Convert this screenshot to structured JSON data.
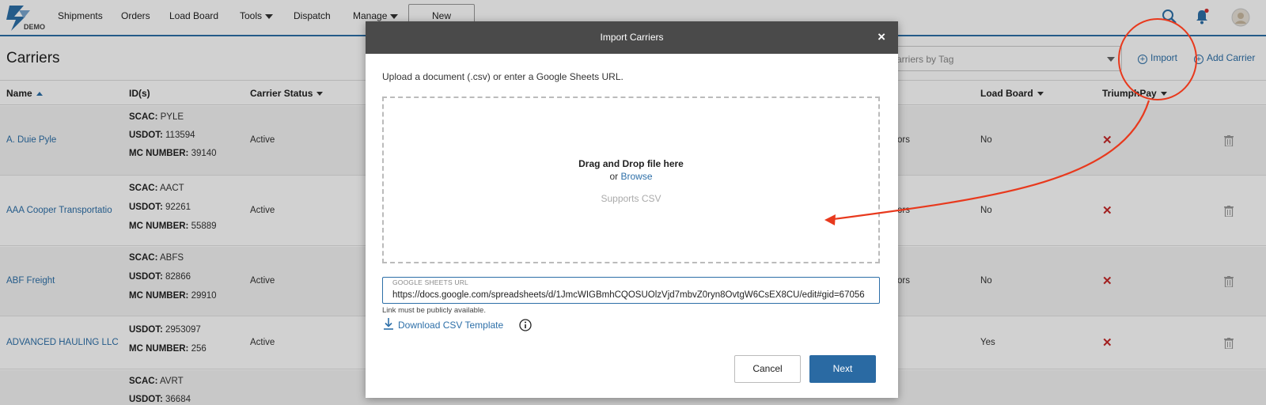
{
  "nav": {
    "logo_text": "DEMO",
    "items": [
      "Shipments",
      "Orders",
      "Load Board",
      "Tools",
      "Dispatch",
      "Manage"
    ],
    "new_label": "New",
    "icons": [
      "search-icon",
      "bell-icon",
      "avatar"
    ],
    "brand_color": "#2d6fa8"
  },
  "page": {
    "title": "Carriers",
    "tag_filter_placeholder": "arriers by Tag",
    "import_label": "Import",
    "add_carrier_label": "Add Carrier"
  },
  "table": {
    "headers": {
      "name": "Name",
      "ids": "ID(s)",
      "status": "Carrier Status",
      "load_board": "Load Board",
      "triumph_pay": "TriumphPay"
    },
    "rows": [
      {
        "name": "A. Duie Pyle",
        "ids": [
          [
            "SCAC:",
            "PYLE"
          ],
          [
            "USDOT:",
            "113594"
          ],
          [
            "MC NUMBER:",
            "39140"
          ]
        ],
        "status": "Active",
        "partial": "ors",
        "load_board": "No"
      },
      {
        "name": "AAA Cooper Transportatio",
        "ids": [
          [
            "SCAC:",
            "AACT"
          ],
          [
            "USDOT:",
            "92261"
          ],
          [
            "MC NUMBER:",
            "55889"
          ]
        ],
        "status": "Active",
        "partial": "ors",
        "load_board": "No"
      },
      {
        "name": "ABF Freight",
        "ids": [
          [
            "SCAC:",
            "ABFS"
          ],
          [
            "USDOT:",
            "82866"
          ],
          [
            "MC NUMBER:",
            "29910"
          ]
        ],
        "status": "Active",
        "partial": "ors",
        "load_board": "No"
      },
      {
        "name": "ADVANCED HAULING LLC",
        "ids": [
          [
            "USDOT:",
            "2953097"
          ],
          [
            "MC NUMBER:",
            "256"
          ]
        ],
        "status": "Active",
        "partial": "",
        "load_board": "Yes"
      },
      {
        "name": "",
        "ids": [
          [
            "SCAC:",
            "AVRT"
          ],
          [
            "USDOT:",
            "36684"
          ]
        ],
        "status": "",
        "partial": "",
        "load_board": ""
      }
    ]
  },
  "modal": {
    "title": "Import Carriers",
    "close_glyph": "×",
    "instructions": "Upload a document (.csv) or enter a Google Sheets URL.",
    "drop_main": "Drag and Drop file here",
    "drop_or": "or",
    "drop_browse": "Browse",
    "drop_support": "Supports CSV",
    "gs_label": "GOOGLE SHEETS URL",
    "gs_value": "https://docs.google.com/spreadsheets/d/1JmcWIGBmhCQOSUOlzVjd7mbvZ0ryn8OvtgW6CsEX8CU/edit#gid=67056",
    "gs_help": "Link must be publicly available.",
    "download_label": "Download CSV Template",
    "cancel_label": "Cancel",
    "next_label": "Next"
  },
  "annotation": {
    "color": "#e8391d"
  }
}
